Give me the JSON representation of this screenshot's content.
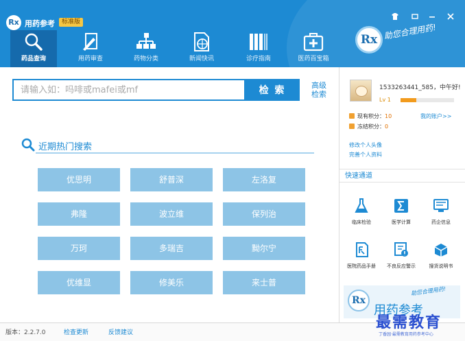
{
  "header": {
    "logo_text": "Rx",
    "app_title": "用药参考",
    "edition_badge": "标准版",
    "window_controls": [
      "shirt-icon",
      "restore-icon",
      "minimize-icon",
      "close-icon"
    ],
    "nav": [
      {
        "label": "药品查询",
        "icon": "search-icon",
        "active": true
      },
      {
        "label": "用药审查",
        "icon": "pen-icon",
        "active": false
      },
      {
        "label": "药物分类",
        "icon": "hierarchy-icon",
        "active": false
      },
      {
        "label": "新闻快讯",
        "icon": "globe-doc-icon",
        "active": false
      },
      {
        "label": "诊疗指南",
        "icon": "books-icon",
        "active": false
      },
      {
        "label": "医药百宝箱",
        "icon": "medkit-icon",
        "active": false
      }
    ],
    "brand_logo": "Rx",
    "slogan": "助您合理用药!"
  },
  "search": {
    "placeholder": "请输入如：吗啡或mafei或mf",
    "value": "",
    "button_label": "检 索",
    "advanced_label": "高级检索"
  },
  "hot": {
    "title": "近期热门搜索",
    "tags": [
      "优思明",
      "舒普深",
      "左洛复",
      "弗隆",
      "波立维",
      "保列治",
      "万珂",
      "多瑞吉",
      "黝尔宁",
      "优维显",
      "修美乐",
      "来士普"
    ]
  },
  "user": {
    "greeting": "1533263441_585，中午好!",
    "level_label": "Lv 1",
    "level_progress": 0.3,
    "points_label": "现有积分：",
    "points_value": "10",
    "frozen_label": "冻结积分：",
    "frozen_value": "0",
    "account_link": "我的账户>>",
    "edit_avatar": "修改个人头像",
    "edit_profile": "完善个人资料"
  },
  "quick": {
    "title": "快速通道",
    "items": [
      {
        "label": "临床检验",
        "icon": "flask-icon"
      },
      {
        "label": "医学计算",
        "icon": "sigma-icon"
      },
      {
        "label": "药企信息",
        "icon": "monitor-icon"
      },
      {
        "label": "医院药品手册",
        "icon": "manual-icon"
      },
      {
        "label": "不良反应警示",
        "icon": "warning-icon"
      },
      {
        "label": "搜货说明书",
        "icon": "package-icon"
      }
    ]
  },
  "ad": {
    "logo": "Rx",
    "title": "用药参考",
    "slogan": "助您合理用药!"
  },
  "status": {
    "version": "版本：2.2.7.0",
    "check_update": "检查更新",
    "feedback": "反馈建议"
  },
  "watermark": {
    "text": "最需教育",
    "sub": "丁香园·最需教育用药参考中心"
  },
  "colors": {
    "primary": "#1d8ad3",
    "primary_dark": "#156aac",
    "tag_bg": "#8dc4e6",
    "points": "#e07000"
  }
}
